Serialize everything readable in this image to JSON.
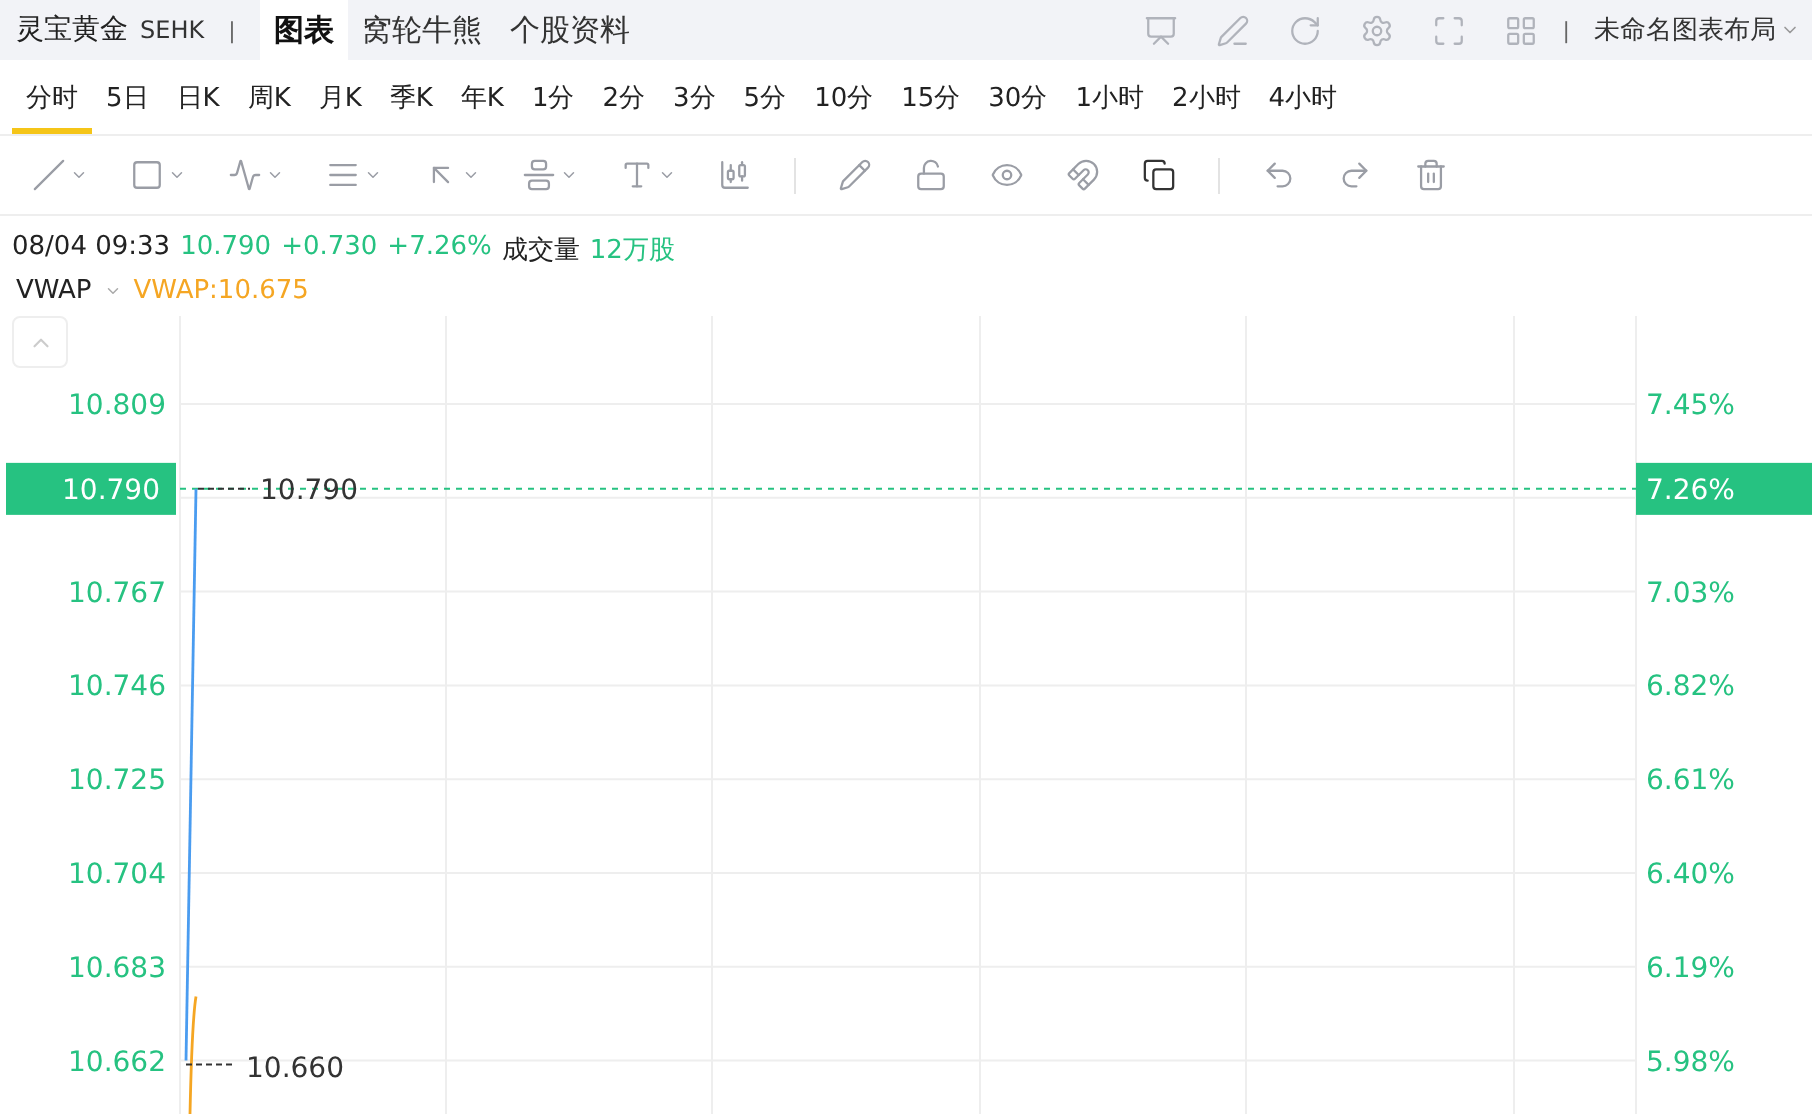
{
  "header": {
    "symbol": "灵宝黄金",
    "exchange": "SEHK",
    "divider": "|",
    "tabs": [
      {
        "label": "图表",
        "selected": true
      },
      {
        "label": "窝轮牛熊",
        "selected": false
      },
      {
        "label": "个股资料",
        "selected": false
      }
    ],
    "layout": "未命名图表布局"
  },
  "periods": [
    {
      "label": "分时",
      "selected": true
    },
    {
      "label": "5日",
      "selected": false
    },
    {
      "label": "日K",
      "selected": false
    },
    {
      "label": "周K",
      "selected": false
    },
    {
      "label": "月K",
      "selected": false
    },
    {
      "label": "季K",
      "selected": false
    },
    {
      "label": "年K",
      "selected": false
    },
    {
      "label": "1分",
      "selected": false
    },
    {
      "label": "2分",
      "selected": false
    },
    {
      "label": "3分",
      "selected": false
    },
    {
      "label": "5分",
      "selected": false
    },
    {
      "label": "10分",
      "selected": false
    },
    {
      "label": "15分",
      "selected": false
    },
    {
      "label": "30分",
      "selected": false
    },
    {
      "label": "1小时",
      "selected": false
    },
    {
      "label": "2小时",
      "selected": false
    },
    {
      "label": "4小时",
      "selected": false
    }
  ],
  "quote": {
    "time": "08/04 09:33",
    "price": "10.790",
    "change": "+0.730",
    "percent": "+7.26%",
    "volume_label": "成交量",
    "volume": "12万股"
  },
  "indicator": {
    "name": "VWAP",
    "value": "VWAP:10.675"
  },
  "chart": {
    "last_price": "10.790",
    "last_percent": "7.26%",
    "high_label": "10.790",
    "low_label": "10.660",
    "percent_ticks": [
      "7.45%",
      "7.03%",
      "6.82%",
      "6.61%",
      "6.40%",
      "6.19%",
      "5.98%"
    ],
    "price_ticks": [
      "10.809",
      "10.767",
      "10.746",
      "10.725",
      "10.704",
      "10.683",
      "10.662"
    ]
  }
}
